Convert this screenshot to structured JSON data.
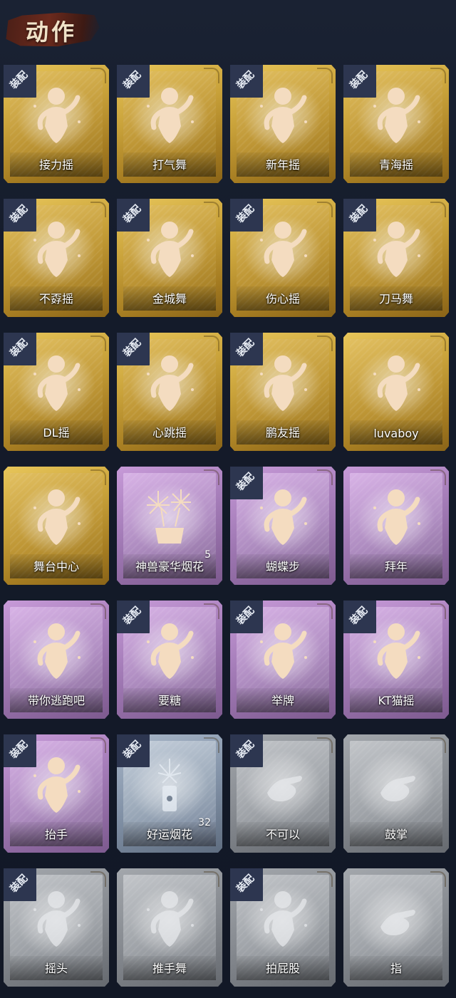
{
  "header": {
    "title": "动作"
  },
  "colors": {
    "gold": "#c9a23a",
    "purple": "#a47cb8",
    "blue": "#8393a8",
    "gray": "#878b91",
    "background": "#141b2a",
    "badge": "#2d3650"
  },
  "equip_label": "装配",
  "cards": [
    {
      "label": "接力摇",
      "tier": "gold",
      "equipped": true,
      "icon": "dance-figure-icon"
    },
    {
      "label": "打气舞",
      "tier": "gold",
      "equipped": true,
      "icon": "dance-figure-icon"
    },
    {
      "label": "新年摇",
      "tier": "gold",
      "equipped": true,
      "icon": "dance-figure-icon"
    },
    {
      "label": "青海摇",
      "tier": "gold",
      "equipped": true,
      "icon": "dance-figure-icon"
    },
    {
      "label": "不孬摇",
      "tier": "gold",
      "equipped": true,
      "icon": "dance-figure-icon"
    },
    {
      "label": "金城舞",
      "tier": "gold",
      "equipped": true,
      "icon": "dance-figure-icon"
    },
    {
      "label": "伤心摇",
      "tier": "gold",
      "equipped": true,
      "icon": "heart-hands-figure-icon"
    },
    {
      "label": "刀马舞",
      "tier": "gold",
      "equipped": true,
      "icon": "dance-figure-icon"
    },
    {
      "label": "DL摇",
      "tier": "gold",
      "equipped": true,
      "icon": "dance-figure-icon"
    },
    {
      "label": "心跳摇",
      "tier": "gold",
      "equipped": true,
      "icon": "dance-figure-icon"
    },
    {
      "label": "鹏友摇",
      "tier": "gold",
      "equipped": true,
      "icon": "dance-figure-icon"
    },
    {
      "label": "luvaboy",
      "tier": "gold",
      "equipped": false,
      "icon": "dance-figure-icon"
    },
    {
      "label": "舞台中心",
      "tier": "gold",
      "equipped": false,
      "icon": "dance-figure-icon"
    },
    {
      "label": "神兽豪华烟花",
      "tier": "purple",
      "equipped": false,
      "icon": "fireworks-icon",
      "count": "5"
    },
    {
      "label": "蝴蝶步",
      "tier": "purple",
      "equipped": true,
      "icon": "pointing-figure-icon"
    },
    {
      "label": "拜年",
      "tier": "purple",
      "equipped": false,
      "icon": "bowing-figure-icon"
    },
    {
      "label": "带你逃跑吧",
      "tier": "purple",
      "equipped": false,
      "icon": "dance-figure-icon"
    },
    {
      "label": "要糖",
      "tier": "purple",
      "equipped": true,
      "icon": "reaching-figure-icon"
    },
    {
      "label": "举牌",
      "tier": "purple",
      "equipped": true,
      "icon": "sign-holding-figure-icon"
    },
    {
      "label": "KT猫摇",
      "tier": "purple",
      "equipped": true,
      "icon": "dance-figure-icon"
    },
    {
      "label": "抬手",
      "tier": "purple",
      "equipped": true,
      "icon": "raising-hand-figure-icon"
    },
    {
      "label": "好运烟花",
      "tier": "blue",
      "equipped": true,
      "icon": "firecracker-icon",
      "count": "32"
    },
    {
      "label": "不可以",
      "tier": "gray",
      "equipped": true,
      "icon": "finger-wag-icon"
    },
    {
      "label": "鼓掌",
      "tier": "gray",
      "equipped": false,
      "icon": "clapping-hands-icon"
    },
    {
      "label": "摇头",
      "tier": "gray",
      "equipped": true,
      "icon": "head-shake-figure-icon"
    },
    {
      "label": "推手舞",
      "tier": "gray",
      "equipped": false,
      "icon": "pushing-hands-figure-icon"
    },
    {
      "label": "拍屁股",
      "tier": "gray",
      "equipped": true,
      "icon": "butt-pat-figure-icon"
    },
    {
      "label": "指",
      "tier": "gray",
      "equipped": false,
      "icon": "pointing-hand-icon"
    }
  ]
}
